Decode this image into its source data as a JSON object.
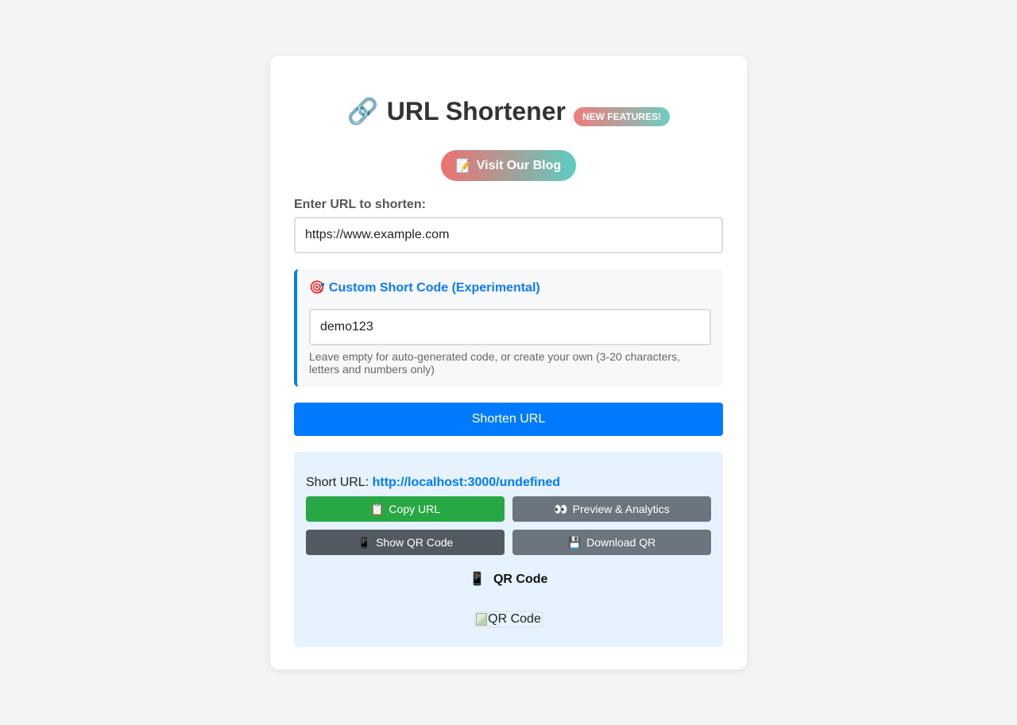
{
  "header": {
    "title_icon": "🔗",
    "title": "URL Shortener",
    "badge": "NEW FEATURES!"
  },
  "blog_button": {
    "icon": "📝",
    "label": "Visit Our Blog"
  },
  "url_form": {
    "label": "Enter URL to shorten:",
    "value": "https://www.example.com"
  },
  "custom_code": {
    "icon": "🎯",
    "title": "Custom Short Code (Experimental)",
    "value": "demo123",
    "hint": "Leave empty for auto-generated code, or create your own (3-20 characters, letters and numbers only)"
  },
  "shorten_button": {
    "label": "Shorten URL"
  },
  "result": {
    "short_url_label": "Short URL:",
    "short_url": "http://localhost:3000/undefined",
    "buttons": [
      {
        "icon": "📋",
        "label": "Copy URL",
        "color": "#28a745"
      },
      {
        "icon": "👀",
        "label": "Preview & Analytics",
        "color": "#6c757d"
      },
      {
        "icon": "📱",
        "label": "Show QR Code",
        "color": "#545a61"
      },
      {
        "icon": "💾",
        "label": "Download QR",
        "color": "#6c757d"
      }
    ],
    "qr_heading_icon": "📱",
    "qr_heading": "QR Code",
    "qr_alt": "QR Code"
  },
  "colors": {
    "accent": "#007bff",
    "background": "#f4f4f4",
    "result_bg": "#e6f2fd"
  }
}
